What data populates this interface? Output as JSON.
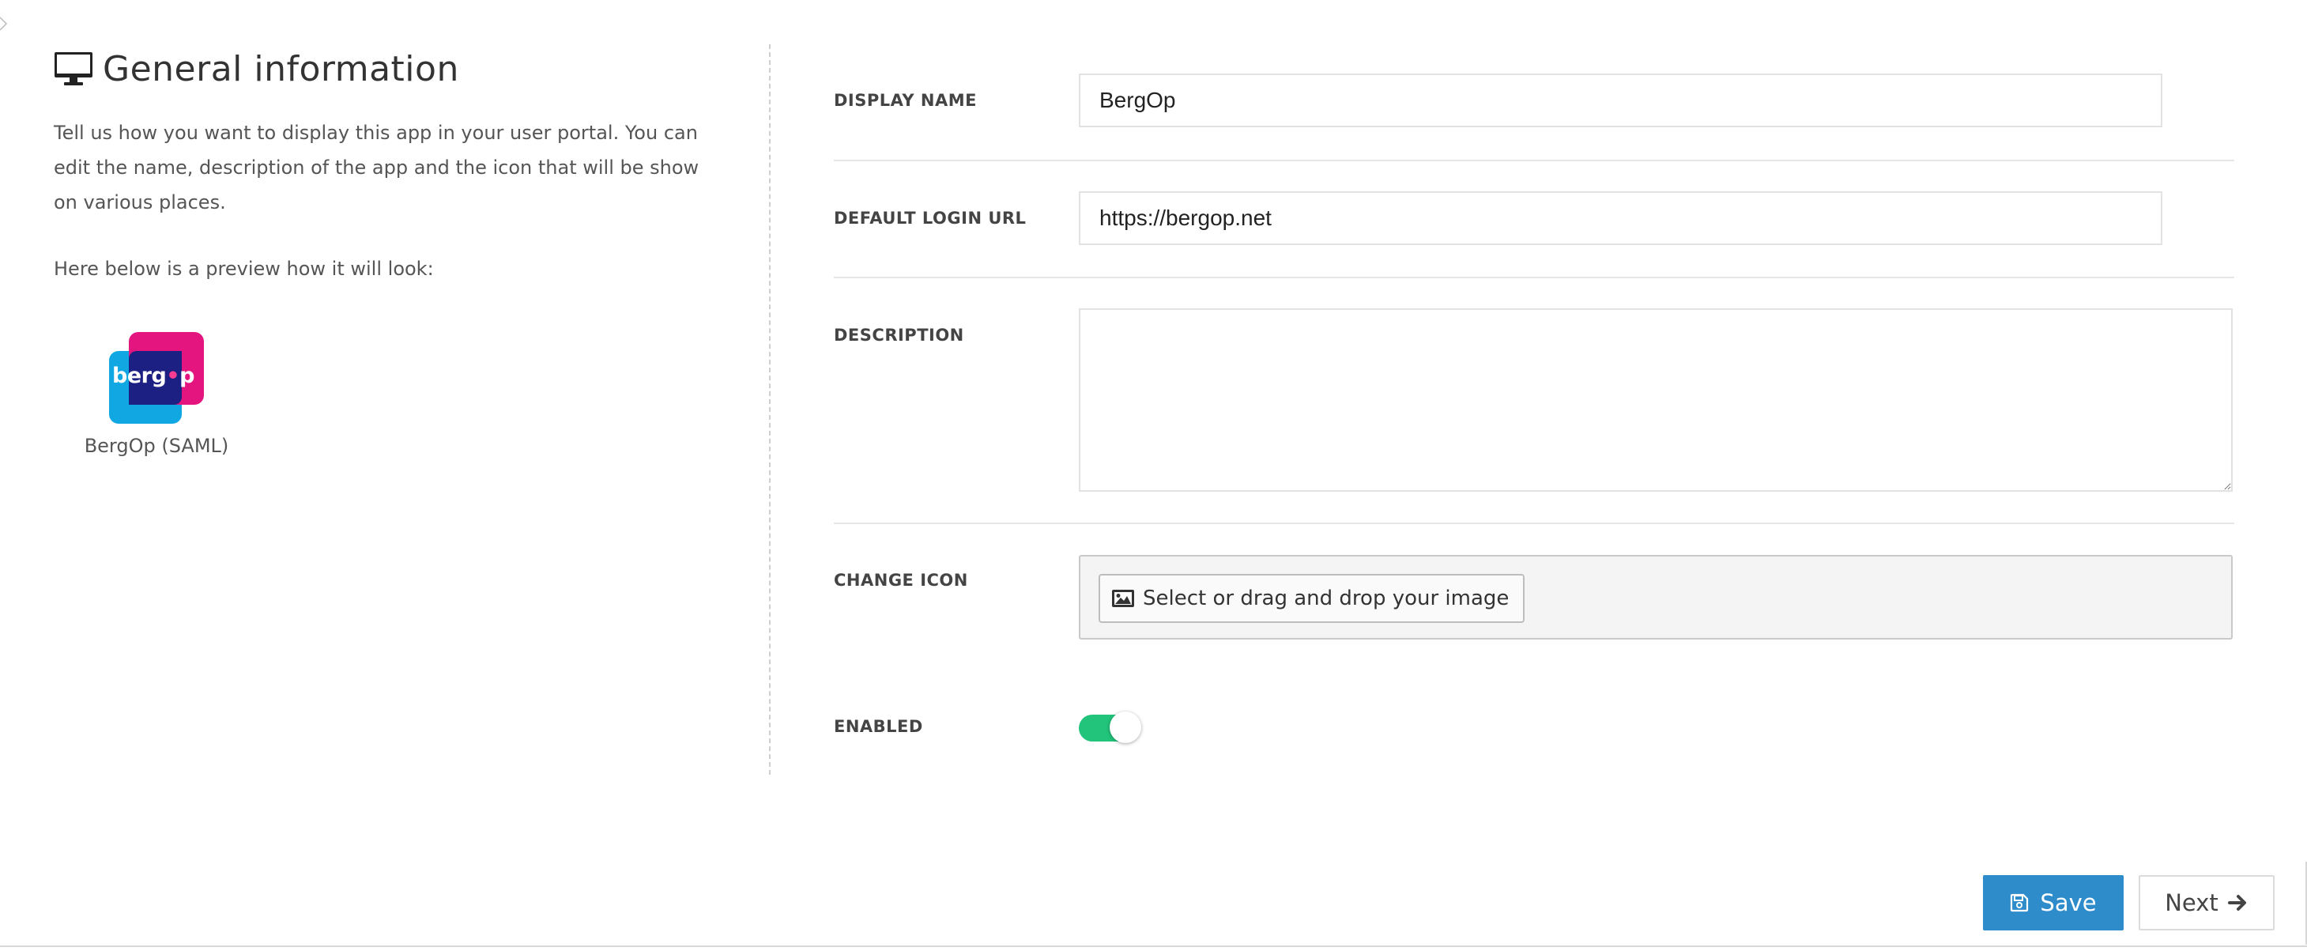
{
  "left": {
    "title": "General information",
    "title_icon": "monitor-icon",
    "intro": "Tell us how you want to display this app in your user portal. You can edit the name, description of the app and the icon that will be show on various places.",
    "preview_label": "Here below is a preview how it will look:",
    "app_icon_text_a": "berg",
    "app_icon_text_dot": "•",
    "app_icon_text_b": "p",
    "app_name": "BergOp (SAML)"
  },
  "form": {
    "display_name": {
      "label": "DISPLAY NAME",
      "value": "BergOp"
    },
    "default_login_url": {
      "label": "DEFAULT LOGIN URL",
      "value": "https://bergop.net"
    },
    "description": {
      "label": "DESCRIPTION",
      "value": ""
    },
    "change_icon": {
      "label": "CHANGE ICON",
      "button_label": "Select or drag and drop your image",
      "button_icon": "image-icon"
    },
    "enabled": {
      "label": "ENABLED",
      "on": true
    }
  },
  "actions": {
    "save_label": "Save",
    "save_icon": "floppy-disk-icon",
    "next_label": "Next",
    "next_icon": "arrow-right-icon"
  },
  "colors": {
    "primary": "#2f8ccb",
    "toggle_on": "#21c47a",
    "brand_blue": "#10a7e3",
    "brand_pink": "#e4157e",
    "brand_navy": "#1c2082"
  }
}
